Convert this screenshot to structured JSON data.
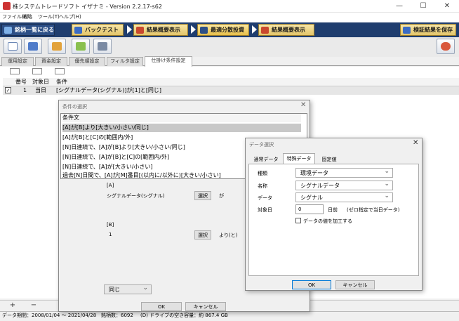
{
  "window": {
    "title": "株システムトレードソフト イザナミ - Version 2.2.17-s62",
    "min": "—",
    "max": "☐",
    "close": "✕"
  },
  "menu": [
    "ファイル(E)",
    "戦略",
    "ツール(T)",
    "ヘルプ(H)"
  ],
  "nav": {
    "back": "銘柄一覧に戻る",
    "backtest": "バックテスト",
    "summary1": "結果概要表示",
    "optimize": "最適分散投資",
    "summary2": "結果概要表示",
    "save": "検証結果を保存"
  },
  "subtabs": [
    "運用設定",
    "資金設定",
    "優先順設定",
    "フィルタ設定",
    "仕掛け条件設定"
  ],
  "grid": {
    "headers": [
      "番号",
      "対象日",
      "条件"
    ],
    "rows": [
      {
        "check": "✓",
        "num": "1",
        "day": "当日",
        "cond": "[シグナルデータ(シグナル)]が[1]と[同じ]"
      }
    ]
  },
  "bottom_buttons": [
    "+",
    "−"
  ],
  "status": {
    "period": "データ期間：2008/01/04 〜 2021/04/28",
    "count": "銘柄数：6092",
    "disk": "(D) ドライブの空き容量：約 867.4 GB"
  },
  "cond_dialog": {
    "title": "条件の選択",
    "list_header": "条件文",
    "items": [
      "[A]が[B]より[大きい/小さい/同じ]",
      "[A]が[B]と[C]の[範囲内/外]",
      "[N]日連続で、[A]が[B]より[大きい/小さい/同じ]",
      "[N]日連続で、[A]が[B]と[C]の[範囲内/外]",
      "[N]日連続で、[A]が[大きい/小さい]",
      "過去[N]日間で、[A]が[M]番目[(以内に/以外に)[大きい/小さい]"
    ],
    "a_label": "[A]",
    "a_value": "シグナルデータ(シグナル)",
    "a_select": "選択",
    "a_suffix": "が",
    "b_label": "[B]",
    "b_value": "1",
    "b_select": "選択",
    "b_suffix": "より(と)",
    "compare": "同じ",
    "ok": "OK",
    "cancel": "キャンセル"
  },
  "data_dialog": {
    "title": "データ選択",
    "tabs": [
      "通常データ",
      "特殊データ",
      "固定値"
    ],
    "fields": [
      {
        "label": "種類",
        "value": "環境データ"
      },
      {
        "label": "名称",
        "value": "シグナルデータ"
      },
      {
        "label": "データ",
        "value": "シグナル"
      }
    ],
    "day_label": "対象日",
    "day_value": "0",
    "day_unit": "日前",
    "day_hint": "(ゼロ指定で当日データ)",
    "process_label": "データの値を加工する",
    "ok": "OK",
    "cancel": "キャンセル"
  }
}
